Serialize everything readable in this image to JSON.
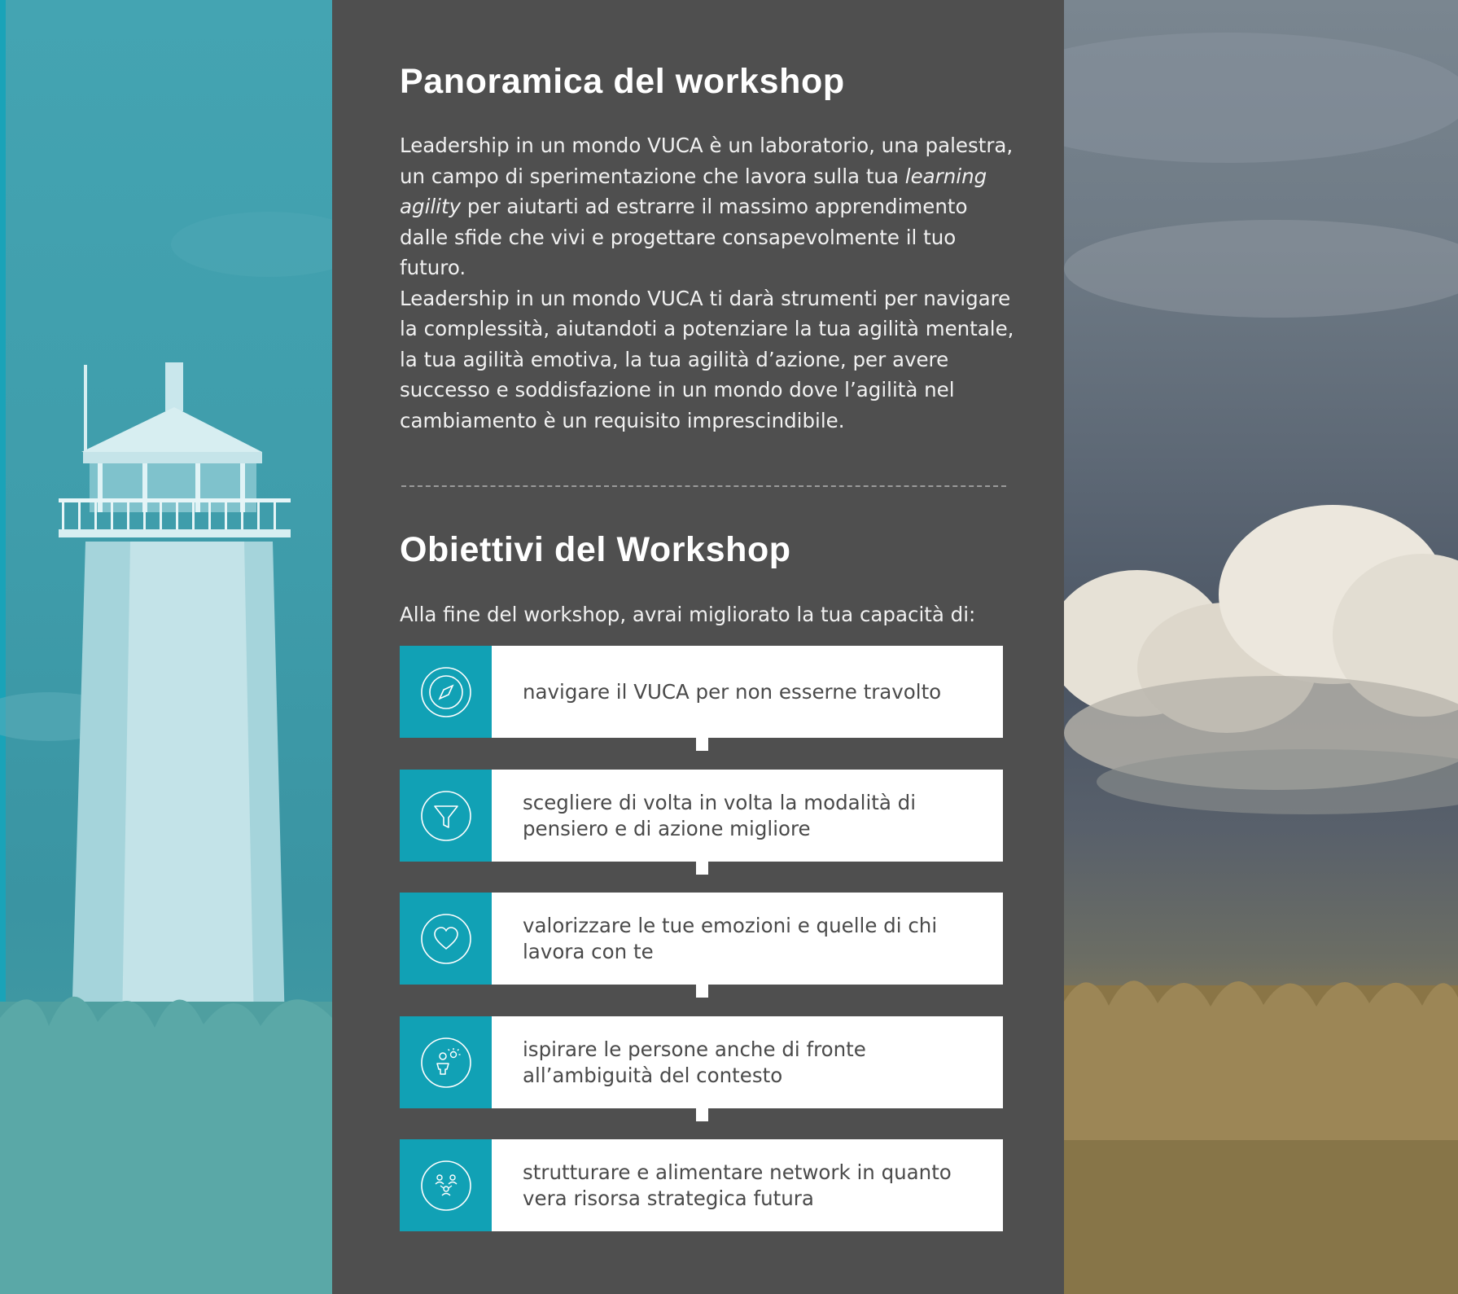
{
  "overview": {
    "title": "Panoramica del workshop",
    "paragraph1_before": "Leadership in un mondo VUCA è un laboratorio, una palestra, un campo di sperimentazione che lavora sulla tua ",
    "paragraph1_emphasis": "learning agility",
    "paragraph1_after": " per aiutarti ad estrarre il massimo apprendimento dalle sfide che vivi e progettare consapevolmente il tuo futuro.",
    "paragraph2": "Leadership in un mondo VUCA ti darà strumenti per navigare la complessità, aiutandoti a potenziare la tua agilità mentale, la tua agilità emotiva, la tua agilità d’azione, per avere successo e soddisfazione in un mondo dove l’agilità nel cambiamento è un requisito imprescindibile."
  },
  "objectives": {
    "title": "Obiettivi del Workshop",
    "intro": "Alla fine del workshop, avrai migliorato la tua capacità di:",
    "items": [
      {
        "icon": "compass-icon",
        "label": "navigare il VUCA per non esserne travolto"
      },
      {
        "icon": "funnel-icon",
        "label": "scegliere di volta in volta la modalità di pensiero e di azione migliore"
      },
      {
        "icon": "heart-icon",
        "label": "valorizzare le tue emozioni e quelle di chi lavora con te"
      },
      {
        "icon": "inspiring-person-icon",
        "label": "ispirare le persone anche di fronte all’ambiguità del contesto"
      },
      {
        "icon": "network-people-icon",
        "label": "strutturare e alimentare network in quanto vera risorsa strategica futura"
      }
    ]
  },
  "colors": {
    "background": "#4f4f4f",
    "accent_teal": "#11a1b5",
    "card_background": "#ffffff",
    "card_text": "#4a4a4a",
    "heading_text": "#ffffff"
  }
}
